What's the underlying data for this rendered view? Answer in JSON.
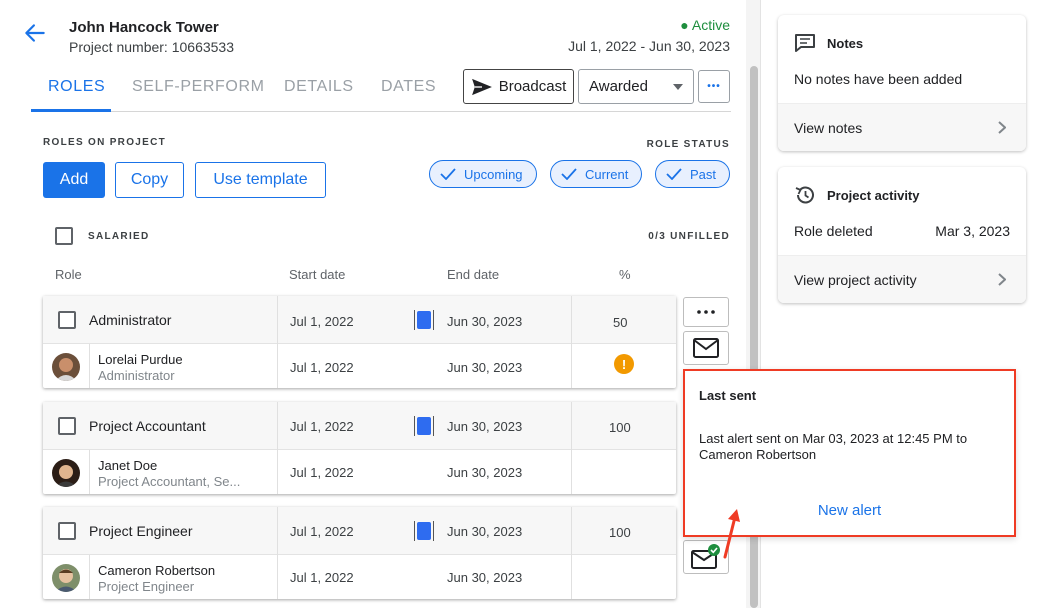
{
  "project": {
    "name": "John Hancock Tower",
    "number": "Project number: 10663533",
    "status": "Active",
    "date_range": "Jul 1, 2022 - Jun 30, 2023"
  },
  "tabs": [
    {
      "label": "ROLES",
      "active": true
    },
    {
      "label": "SELF-PERFORM",
      "active": false
    },
    {
      "label": "DETAILS",
      "active": false
    },
    {
      "label": "DATES",
      "active": false
    }
  ],
  "toolbar": {
    "broadcast_label": "Broadcast",
    "status_select": "Awarded",
    "more_label": "•••"
  },
  "roles_section": {
    "heading": "ROLES ON PROJECT",
    "role_status_heading": "ROLE STATUS",
    "add_label": "Add",
    "copy_label": "Copy",
    "template_label": "Use template",
    "status_filters": [
      "Upcoming",
      "Current",
      "Past"
    ],
    "salaried_label": "SALARIED",
    "unfilled": "0/3 UNFILLED"
  },
  "columns": {
    "role": "Role",
    "start": "Start date",
    "end": "End date",
    "percent": "%"
  },
  "roles": [
    {
      "role": "Administrator",
      "start": "Jul 1, 2022",
      "end": "Jun 30, 2023",
      "percent": "50",
      "person": "Lorelai Purdue",
      "person_role": "Administrator",
      "person_start": "Jul 1, 2022",
      "person_end": "Jun 30, 2023",
      "warning": "!"
    },
    {
      "role": "Project Accountant",
      "start": "Jul 1, 2022",
      "end": "Jun 30, 2023",
      "percent": "100",
      "person": "Janet Doe",
      "person_role": "Project Accountant, Se...",
      "person_start": "Jul 1, 2022",
      "person_end": "Jun 30, 2023"
    },
    {
      "role": "Project Engineer",
      "start": "Jul 1, 2022",
      "end": "Jun 30, 2023",
      "percent": "100",
      "person": "Cameron Robertson",
      "person_role": "Project Engineer",
      "person_start": "Jul 1, 2022",
      "person_end": "Jun 30, 2023"
    }
  ],
  "popover": {
    "title": "Last sent",
    "body": "Last alert sent on Mar 03, 2023 at 12:45 PM to Cameron Robertson",
    "link": "New alert"
  },
  "notes": {
    "title": "Notes",
    "empty_text": "No notes have been added",
    "link": "View notes"
  },
  "activity": {
    "title": "Project activity",
    "event": "Role deleted",
    "event_date": "Mar 3, 2023",
    "link": "View project activity"
  },
  "icons": {
    "back": "arrow-left-icon",
    "broadcast": "send-icon",
    "select": "caret-down-icon",
    "more": "more-horizontal-icon",
    "filter_check": "check-icon",
    "mail": "mail-icon",
    "mail_sent": "mail-check-icon",
    "warning": "warning-icon",
    "notes": "comment-icon",
    "activity": "history-icon",
    "chevron": "chevron-right-icon"
  },
  "colors": {
    "accent": "#1a73e8",
    "active_status": "#1e8e3e",
    "warning": "#f29900",
    "highlight": "#ef3b24"
  }
}
